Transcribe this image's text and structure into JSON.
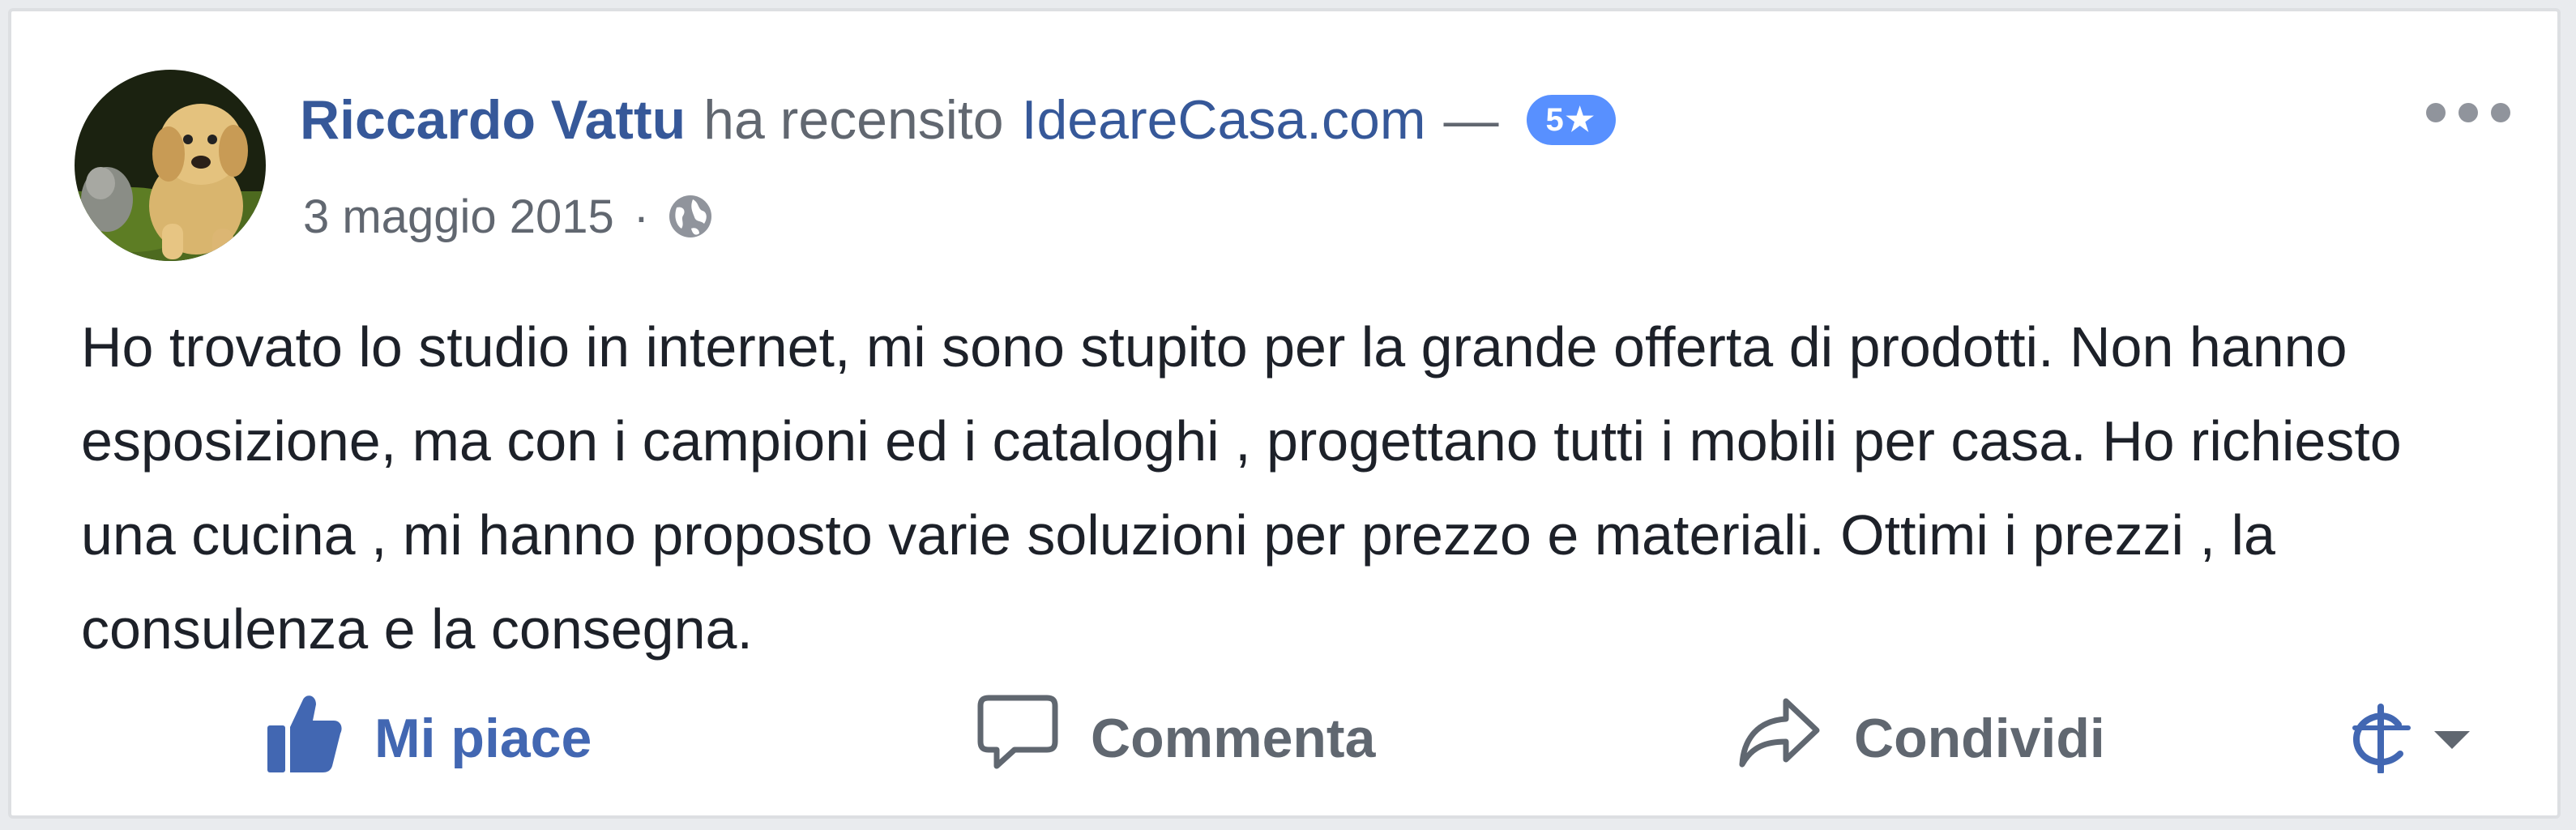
{
  "post": {
    "author": "Riccardo Vattu",
    "action_text": "ha recensito",
    "page_name": "IdeareCasa.com",
    "dash": "—",
    "rating": "5★",
    "date": "3 maggio 2015",
    "separator": "·",
    "privacy_icon": "globe-icon",
    "more_icon": "more-icon",
    "avatar_icon": "puppy-photo",
    "review_text": "Ho trovato lo studio in internet, mi sono stupito per la grande offerta di prodotti. Non hanno esposizione, ma con i campioni ed i cataloghi , progettano tutti i mobili per casa. Ho richiesto una cucina , mi hanno proposto varie soluzioni per prezzo e materiali. Ottimi i prezzi , la consulenza e la consegna."
  },
  "actions": {
    "like_label": "Mi piace",
    "comment_label": "Commenta",
    "share_label": "Condividi",
    "like_icon": "thumbs-up-icon",
    "comment_icon": "comment-bubble-icon",
    "share_icon": "share-arrow-icon",
    "audience_icon": "audience-selector-icon"
  },
  "colors": {
    "link_blue": "#365899",
    "like_blue": "#4267b2",
    "badge_blue": "#5890ff",
    "text": "#1d2129",
    "secondary_text": "#616770",
    "border": "#dddfe2"
  }
}
